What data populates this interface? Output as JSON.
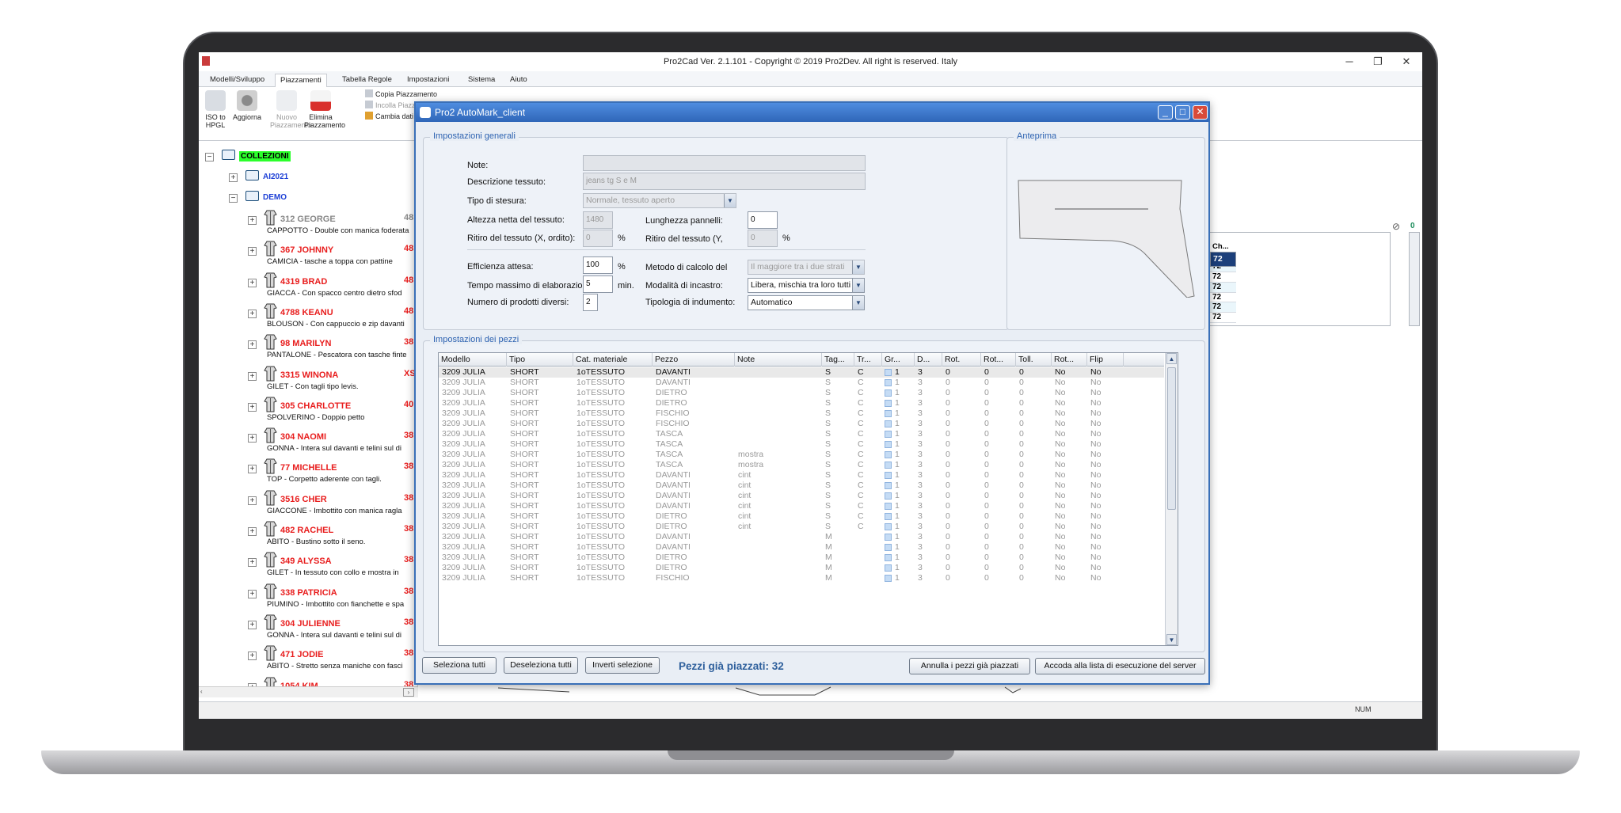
{
  "window": {
    "title": "Pro2Cad Ver. 2.1.101 - Copyright © 2019 Pro2Dev. All right is reserved. Italy",
    "min": "─",
    "max": "❐",
    "close": "✕"
  },
  "ribbon_tabs": [
    "Modelli/Sviluppo",
    "Piazzamenti",
    "Tabella Regole",
    "Impostazioni",
    "Sistema",
    "Aiuto"
  ],
  "ribbon_buttons": {
    "iso": "ISO to HPGL",
    "aggiorna": "Aggiorna",
    "nuovo": "Nuovo Piazzamento",
    "elimina": "Elimina Piazzamento"
  },
  "ribbon_small": {
    "copia": "Copia Piazzamento",
    "incolla": "Incolla Piazz",
    "cambia": "Cambia dati"
  },
  "tree": {
    "root": "COLLEZIONI",
    "ai": "AI2021",
    "demo": "DEMO",
    "models": [
      {
        "name": "312 GEORGE",
        "size": "48",
        "desc": "CAPPOTTO - Double con manica foderata",
        "gray": true
      },
      {
        "name": "367 JOHNNY",
        "size": "48",
        "desc": "CAMICIA - tasche a toppa con pattine"
      },
      {
        "name": "4319 BRAD",
        "size": "48",
        "desc": "GIACCA - Con spacco centro dietro sfod"
      },
      {
        "name": "4788 KEANU",
        "size": "48",
        "desc": "BLOUSON - Con cappuccio e zip davanti"
      },
      {
        "name": "98 MARILYN",
        "size": "38",
        "desc": "PANTALONE - Pescatora con tasche finte"
      },
      {
        "name": "3315 WINONA",
        "size": "XS",
        "desc": "GILET - Con tagli tipo levis."
      },
      {
        "name": "305 CHARLOTTE",
        "size": "40",
        "desc": "SPOLVERINO - Doppio petto"
      },
      {
        "name": "304 NAOMI",
        "size": "38",
        "desc": "GONNA - Intera sul davanti e telini sul di"
      },
      {
        "name": "77 MICHELLE",
        "size": "38",
        "desc": "TOP - Corpetto aderente con tagli."
      },
      {
        "name": "3516 CHER",
        "size": "38",
        "desc": "GIACCONE - Imbottito con manica ragla"
      },
      {
        "name": "482 RACHEL",
        "size": "38",
        "desc": "ABITO - Bustino sotto il seno."
      },
      {
        "name": "349 ALYSSA",
        "size": "38",
        "desc": "GILET - In tessuto con collo e mostra in"
      },
      {
        "name": "338 PATRICIA",
        "size": "38",
        "desc": "PIUMINO - Imbottito con fianchette e spa"
      },
      {
        "name": "304 JULIENNE",
        "size": "38",
        "desc": "GONNA - Intera sul davanti e telini sul di"
      },
      {
        "name": "471 JODIE",
        "size": "38",
        "desc": "ABITO - Stretto senza maniche con fasci"
      },
      {
        "name": "1054 KIM",
        "size": "38",
        "desc": ""
      }
    ]
  },
  "right_table": {
    "header": "Ch...",
    "values": [
      "72",
      "72",
      "72",
      "72",
      "72",
      "72",
      "72",
      "72"
    ],
    "clip_icon": "0"
  },
  "status": {
    "num": "NUM"
  },
  "dialog": {
    "title": "Pro2 AutoMark_client",
    "general_title": "Impostazioni generali",
    "preview_title": "Anteprima",
    "pieces_title": "Impostazioni dei pezzi",
    "labels": {
      "note": "Note:",
      "descr": "Descrizione tessuto:",
      "tipo": "Tipo di stesura:",
      "altezza": "Altezza netta del tessuto:",
      "ritiro_x": "Ritiro del tessuto (X, ordito):",
      "lunghezza": "Lunghezza pannelli:",
      "ritiro_y": "Ritiro del tessuto (Y,",
      "efficienza": "Efficienza attesa:",
      "tempo": "Tempo massimo di elaborazione:",
      "numero": "Numero di prodotti diversi:",
      "metodo": "Metodo di calcolo del",
      "modalita": "Modalità di incastro:",
      "tipologia": "Tipologia di indumento:",
      "pct1": "%",
      "pct2": "%",
      "pct3": "%",
      "min": "min."
    },
    "values": {
      "note": "",
      "descr": "jeans tg S e M",
      "tipo": "Normale, tessuto aperto",
      "altezza": "1480",
      "ritiro_x": "0",
      "lunghezza": "0",
      "ritiro_y": "0",
      "efficienza": "100",
      "tempo": "5",
      "numero": "2",
      "metodo": "Il maggiore tra i due strati",
      "modalita": "Libera, mischia tra loro tutti i",
      "tipologia": "Automatico"
    },
    "columns": [
      "Modello",
      "Tipo",
      "Cat. materiale",
      "Pezzo",
      "Note",
      "Tag...",
      "Tr...",
      "Gr...",
      "D...",
      "Rot.",
      "Rot...",
      "Toll.",
      "Rot...",
      "Flip"
    ],
    "rows": [
      [
        "3209 JULIA",
        "SHORT",
        "1oTESSUTO",
        "DAVANTI",
        "",
        "S",
        "C",
        "1",
        "3",
        "0",
        "0",
        "0",
        "No",
        "No"
      ],
      [
        "3209 JULIA",
        "SHORT",
        "1oTESSUTO",
        "DAVANTI",
        "",
        "S",
        "C",
        "1",
        "3",
        "0",
        "0",
        "0",
        "No",
        "No"
      ],
      [
        "3209 JULIA",
        "SHORT",
        "1oTESSUTO",
        "DIETRO",
        "",
        "S",
        "C",
        "1",
        "3",
        "0",
        "0",
        "0",
        "No",
        "No"
      ],
      [
        "3209 JULIA",
        "SHORT",
        "1oTESSUTO",
        "DIETRO",
        "",
        "S",
        "C",
        "1",
        "3",
        "0",
        "0",
        "0",
        "No",
        "No"
      ],
      [
        "3209 JULIA",
        "SHORT",
        "1oTESSUTO",
        "FISCHIO",
        "",
        "S",
        "C",
        "1",
        "3",
        "0",
        "0",
        "0",
        "No",
        "No"
      ],
      [
        "3209 JULIA",
        "SHORT",
        "1oTESSUTO",
        "FISCHIO",
        "",
        "S",
        "C",
        "1",
        "3",
        "0",
        "0",
        "0",
        "No",
        "No"
      ],
      [
        "3209 JULIA",
        "SHORT",
        "1oTESSUTO",
        "TASCA",
        "",
        "S",
        "C",
        "1",
        "3",
        "0",
        "0",
        "0",
        "No",
        "No"
      ],
      [
        "3209 JULIA",
        "SHORT",
        "1oTESSUTO",
        "TASCA",
        "",
        "S",
        "C",
        "1",
        "3",
        "0",
        "0",
        "0",
        "No",
        "No"
      ],
      [
        "3209 JULIA",
        "SHORT",
        "1oTESSUTO",
        "TASCA",
        "mostra",
        "S",
        "C",
        "1",
        "3",
        "0",
        "0",
        "0",
        "No",
        "No"
      ],
      [
        "3209 JULIA",
        "SHORT",
        "1oTESSUTO",
        "TASCA",
        "mostra",
        "S",
        "C",
        "1",
        "3",
        "0",
        "0",
        "0",
        "No",
        "No"
      ],
      [
        "3209 JULIA",
        "SHORT",
        "1oTESSUTO",
        "DAVANTI",
        "cint",
        "S",
        "C",
        "1",
        "3",
        "0",
        "0",
        "0",
        "No",
        "No"
      ],
      [
        "3209 JULIA",
        "SHORT",
        "1oTESSUTO",
        "DAVANTI",
        "cint",
        "S",
        "C",
        "1",
        "3",
        "0",
        "0",
        "0",
        "No",
        "No"
      ],
      [
        "3209 JULIA",
        "SHORT",
        "1oTESSUTO",
        "DAVANTI",
        "cint",
        "S",
        "C",
        "1",
        "3",
        "0",
        "0",
        "0",
        "No",
        "No"
      ],
      [
        "3209 JULIA",
        "SHORT",
        "1oTESSUTO",
        "DAVANTI",
        "cint",
        "S",
        "C",
        "1",
        "3",
        "0",
        "0",
        "0",
        "No",
        "No"
      ],
      [
        "3209 JULIA",
        "SHORT",
        "1oTESSUTO",
        "DIETRO",
        "cint",
        "S",
        "C",
        "1",
        "3",
        "0",
        "0",
        "0",
        "No",
        "No"
      ],
      [
        "3209 JULIA",
        "SHORT",
        "1oTESSUTO",
        "DIETRO",
        "cint",
        "S",
        "C",
        "1",
        "3",
        "0",
        "0",
        "0",
        "No",
        "No"
      ],
      [
        "3209 JULIA",
        "SHORT",
        "1oTESSUTO",
        "DAVANTI",
        "",
        "M",
        "",
        "1",
        "3",
        "0",
        "0",
        "0",
        "No",
        "No"
      ],
      [
        "3209 JULIA",
        "SHORT",
        "1oTESSUTO",
        "DAVANTI",
        "",
        "M",
        "",
        "1",
        "3",
        "0",
        "0",
        "0",
        "No",
        "No"
      ],
      [
        "3209 JULIA",
        "SHORT",
        "1oTESSUTO",
        "DIETRO",
        "",
        "M",
        "",
        "1",
        "3",
        "0",
        "0",
        "0",
        "No",
        "No"
      ],
      [
        "3209 JULIA",
        "SHORT",
        "1oTESSUTO",
        "DIETRO",
        "",
        "M",
        "",
        "1",
        "3",
        "0",
        "0",
        "0",
        "No",
        "No"
      ],
      [
        "3209 JULIA",
        "SHORT",
        "1oTESSUTO",
        "FISCHIO",
        "",
        "M",
        "",
        "1",
        "3",
        "0",
        "0",
        "0",
        "No",
        "No"
      ]
    ],
    "buttons": {
      "sel_all": "Seleziona tutti",
      "desel_all": "Deseleziona tutti",
      "invert": "Inverti selezione",
      "placed": "Pezzi già piazzati: 32",
      "cancel_placed": "Annulla i pezzi già piazzati",
      "queue": "Accoda alla lista di esecuzione del server"
    }
  }
}
